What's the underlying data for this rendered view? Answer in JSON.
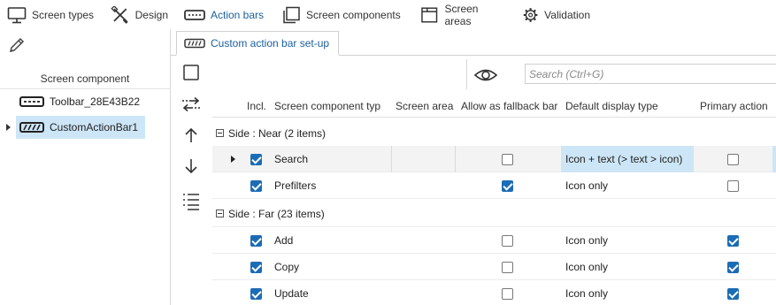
{
  "top_tabs": [
    {
      "label": "Screen types",
      "icon": "monitor-icon"
    },
    {
      "label": "Design",
      "icon": "design-tools-icon"
    },
    {
      "label": "Action bars",
      "icon": "action-bar-icon",
      "active": true
    },
    {
      "label": "Screen components",
      "icon": "screen-components-icon"
    },
    {
      "label": "Screen areas",
      "icon": "screen-areas-icon"
    },
    {
      "label": "Validation",
      "icon": "validation-gear-icon"
    }
  ],
  "left_panel": {
    "header": "Screen component",
    "items": [
      {
        "label": "Toolbar_28E43B22",
        "icon": "toolbar-icon"
      },
      {
        "label": "CustomActionBar1",
        "icon": "custom-action-bar-icon",
        "selected": true
      }
    ]
  },
  "right_tab": {
    "label": "Custom action bar set-up"
  },
  "search": {
    "placeholder": "Search (Ctrl+G)"
  },
  "grid": {
    "columns": [
      "Incl.",
      "Screen component typ",
      "Screen area",
      "Allow as fallback bar",
      "Default display type",
      "Primary action"
    ],
    "groups": [
      {
        "label": "Side : Near (2 items)",
        "rows": [
          {
            "included": true,
            "name": "Search",
            "screen_area": "",
            "fallback": false,
            "display_type": "Icon + text (> text > icon)",
            "primary": false,
            "current": true
          },
          {
            "included": true,
            "name": "Prefilters",
            "screen_area": "",
            "fallback": true,
            "display_type": "Icon only",
            "primary": false
          }
        ]
      },
      {
        "label": "Side : Far (23 items)",
        "rows": [
          {
            "included": true,
            "name": "Add",
            "screen_area": "",
            "fallback": false,
            "display_type": "Icon only",
            "primary": true
          },
          {
            "included": true,
            "name": "Copy",
            "screen_area": "",
            "fallback": false,
            "display_type": "Icon only",
            "primary": true
          },
          {
            "included": true,
            "name": "Update",
            "screen_area": "",
            "fallback": false,
            "display_type": "Icon only",
            "primary": true
          }
        ]
      }
    ]
  },
  "colors": {
    "accent": "#1c6cb5",
    "selection": "#cde6f7",
    "active_tab_text": "#1a5f9e"
  }
}
